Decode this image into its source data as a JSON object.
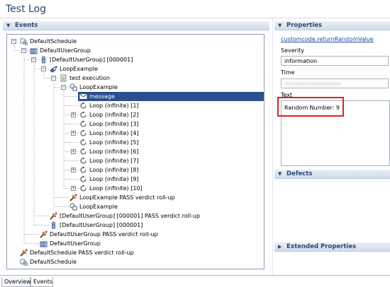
{
  "window": {
    "title": "Test Log"
  },
  "events": {
    "header": "Events",
    "rows": [
      {
        "label": "DefaultSchedule",
        "icon": "schedule-icon",
        "expander": "−"
      },
      {
        "label": "DefaultUserGroup",
        "icon": "user-group-icon",
        "expander": "−"
      },
      {
        "label": "[DefaultUserGroup] [000001]",
        "icon": "user-icon",
        "expander": "−"
      },
      {
        "label": "LoopExample",
        "icon": "test-icon",
        "expander": "−"
      },
      {
        "label": "test execution",
        "icon": "document-icon",
        "expander": "−"
      },
      {
        "label": "LoopExample",
        "icon": "loop-start-icon",
        "expander": "−"
      },
      {
        "label": "message",
        "icon": "message-icon",
        "expander": ""
      },
      {
        "label": "Loop (infinite) [1]",
        "icon": "loop-icon",
        "expander": ""
      },
      {
        "label": "Loop (infinite) [2]",
        "icon": "loop-icon",
        "expander": "+"
      },
      {
        "label": "Loop (infinite) [3]",
        "icon": "loop-icon",
        "expander": ""
      },
      {
        "label": "Loop (infinite) [4]",
        "icon": "loop-icon",
        "expander": "+"
      },
      {
        "label": "Loop (infinite) [5]",
        "icon": "loop-icon",
        "expander": ""
      },
      {
        "label": "Loop (infinite) [6]",
        "icon": "loop-icon",
        "expander": "+"
      },
      {
        "label": "Loop (infinite) [7]",
        "icon": "loop-icon",
        "expander": ""
      },
      {
        "label": "Loop (infinite) [8]",
        "icon": "loop-icon",
        "expander": "+"
      },
      {
        "label": "Loop (infinite) [9]",
        "icon": "loop-icon",
        "expander": ""
      },
      {
        "label": "Loop (infinite) [10]",
        "icon": "loop-icon",
        "expander": "+"
      },
      {
        "label": "LoopExample PASS verdict roll-up",
        "icon": "verdict-icon",
        "expander": ""
      },
      {
        "label": "LoopExample",
        "icon": "loop-end-icon",
        "expander": ""
      },
      {
        "label": "[DefaultUserGroup] [000001] PASS verdict roll-up",
        "icon": "verdict-icon",
        "expander": ""
      },
      {
        "label": "[DefaultUserGroup] [000001]",
        "icon": "user-icon",
        "expander": ""
      },
      {
        "label": "DefaultUserGroup PASS verdict roll-up",
        "icon": "verdict-icon",
        "expander": ""
      },
      {
        "label": "DefaultUserGroup",
        "icon": "user-group-icon",
        "expander": ""
      },
      {
        "label": "DefaultSchedule PASS verdict roll-up",
        "icon": "verdict-icon",
        "expander": ""
      },
      {
        "label": "DefaultSchedule",
        "icon": "schedule-icon",
        "expander": ""
      }
    ]
  },
  "properties": {
    "header": "Properties",
    "link": "customcode.returnRandomValue",
    "severity_label": "Severity",
    "severity_value": "information",
    "time_label": "Time",
    "time_value": "xxxxxxxxxxxxxxxxx",
    "text_label": "Text",
    "text_value": "Random Number: 9"
  },
  "defects": {
    "header": "Defects"
  },
  "extended": {
    "header": "Extended Properties"
  },
  "tabs": [
    {
      "label": "Overview",
      "active": false
    },
    {
      "label": "Events",
      "active": true
    }
  ],
  "colors": {
    "selection": "#2b4f8c",
    "highlight_box": "#e02020",
    "title": "#27436b"
  }
}
